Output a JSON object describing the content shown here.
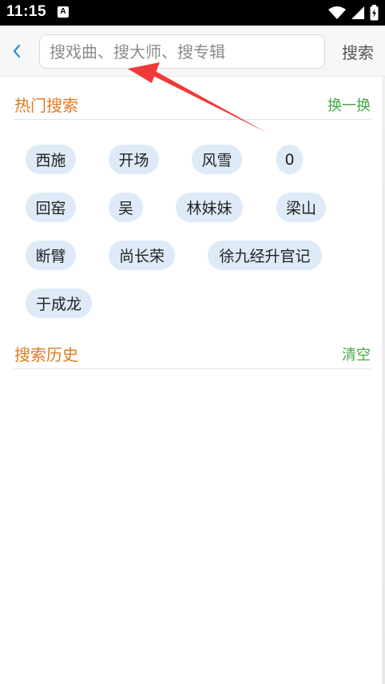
{
  "status_bar": {
    "time": "11:15",
    "notification_icon": "A",
    "icons": [
      "wifi-icon",
      "signal-icon",
      "battery-icon"
    ]
  },
  "header": {
    "back_icon": "chevron-left-icon",
    "search_placeholder": "搜戏曲、搜大师、搜专辑",
    "search_value": "",
    "search_button": "搜索"
  },
  "hot_search": {
    "title": "热门搜索",
    "action": "换一换",
    "tags": [
      "西施",
      "开场",
      "风雪",
      "0",
      "回窑",
      "吴",
      "林妹妹",
      "梁山",
      "断臂",
      "尚长荣",
      "徐九经升官记",
      "于成龙"
    ]
  },
  "history": {
    "title": "搜索历史",
    "action": "清空",
    "items": []
  },
  "colors": {
    "accent_orange": "#e07b22",
    "accent_green": "#45a845",
    "tag_background": "#deeaf7",
    "back_icon": "#2b8fd6",
    "annotation_arrow": "#f03a3a"
  }
}
